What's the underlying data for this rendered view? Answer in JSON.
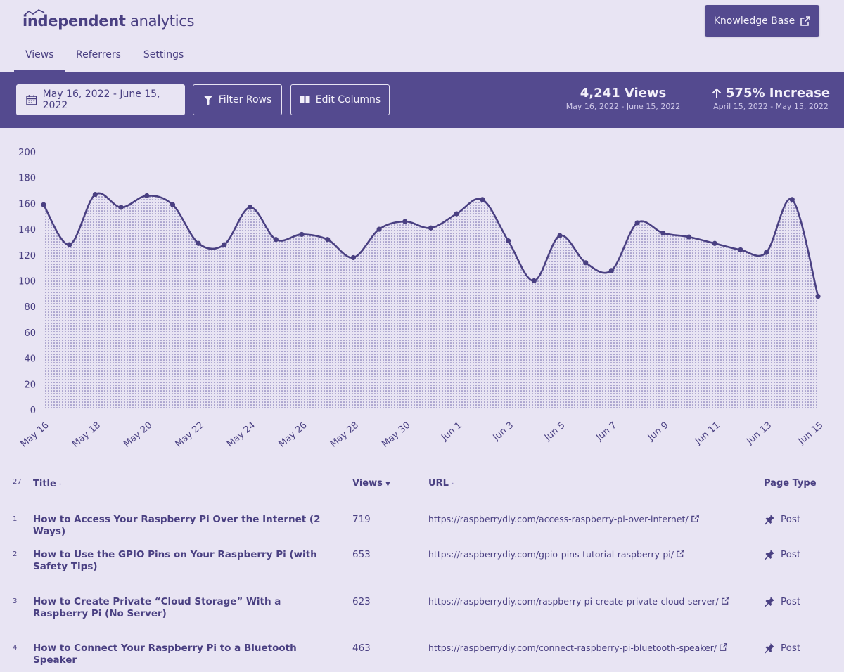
{
  "app": {
    "logo_bold": "independent",
    "logo_light": " analytics",
    "kb_button": "Knowledge Base"
  },
  "tabs": [
    {
      "label": "Views",
      "active": true
    },
    {
      "label": "Referrers",
      "active": false
    },
    {
      "label": "Settings",
      "active": false
    }
  ],
  "toolbar": {
    "date_range": "May 16, 2022 - June 15, 2022",
    "filter_label": "Filter Rows",
    "columns_label": "Edit Columns",
    "views_value": "4,241 Views",
    "views_range": "May 16, 2022 - June 15, 2022",
    "increase_value": "575% Increase",
    "increase_range": "April 15, 2022 - May 15, 2022"
  },
  "colors": {
    "accent": "#544a8f",
    "background": "#e8e4f3",
    "text": "#4a4082"
  },
  "icons": {
    "calendar": "calendar-icon",
    "filter": "filter-icon",
    "columns": "columns-icon",
    "external": "external-link-icon",
    "arrow_up": "arrow-up-icon",
    "pin": "pin-icon"
  },
  "chart_data": {
    "type": "area",
    "title": "",
    "xlabel": "",
    "ylabel": "",
    "ylim": [
      0,
      200
    ],
    "yticks": [
      0,
      20,
      40,
      60,
      80,
      100,
      120,
      140,
      160,
      180,
      200
    ],
    "grid": false,
    "x": [
      "May 16",
      "May 17",
      "May 18",
      "May 19",
      "May 20",
      "May 21",
      "May 22",
      "May 23",
      "May 24",
      "May 25",
      "May 26",
      "May 27",
      "May 28",
      "May 29",
      "May 30",
      "May 31",
      "Jun 1",
      "Jun 2",
      "Jun 3",
      "Jun 4",
      "Jun 5",
      "Jun 6",
      "Jun 7",
      "Jun 8",
      "Jun 9",
      "Jun 10",
      "Jun 11",
      "Jun 12",
      "Jun 13",
      "Jun 14",
      "Jun 15"
    ],
    "xtick_labels": [
      "May 16",
      "May 18",
      "May 20",
      "May 22",
      "May 24",
      "May 26",
      "May 28",
      "May 30",
      "Jun 1",
      "Jun 3",
      "Jun 5",
      "Jun 7",
      "Jun 9",
      "Jun 11",
      "Jun 13",
      "Jun 15"
    ],
    "series": [
      {
        "values": [
          159,
          128,
          167,
          157,
          166,
          159,
          129,
          128,
          157,
          132,
          136,
          132,
          118,
          140,
          146,
          141,
          152,
          163,
          131,
          100,
          135,
          114,
          108,
          145,
          137,
          134,
          129,
          124,
          122,
          163,
          88
        ]
      }
    ]
  },
  "table": {
    "headers": {
      "num": "27",
      "title": "Title",
      "views": "Views",
      "url": "URL",
      "type": "Page Type"
    },
    "rows": [
      {
        "num": "1",
        "title": "How to Access Your Raspberry Pi Over the Internet (2 Ways)",
        "views": "719",
        "url": "https://raspberrydiy.com/access-raspberry-pi-over-internet/",
        "type": "Post"
      },
      {
        "num": "2",
        "title": "How to Use the GPIO Pins on Your Raspberry Pi (with Safety Tips)",
        "views": "653",
        "url": "https://raspberrydiy.com/gpio-pins-tutorial-raspberry-pi/",
        "type": "Post"
      },
      {
        "num": "3",
        "title": "How to Create Private “Cloud Storage” With a Raspberry Pi (No Server)",
        "views": "623",
        "url": "https://raspberrydiy.com/raspberry-pi-create-private-cloud-server/",
        "type": "Post"
      },
      {
        "num": "4",
        "title": "How to Connect Your Raspberry Pi to a Bluetooth Speaker",
        "views": "463",
        "url": "https://raspberrydiy.com/connect-raspberry-pi-bluetooth-speaker/",
        "type": "Post"
      }
    ]
  }
}
